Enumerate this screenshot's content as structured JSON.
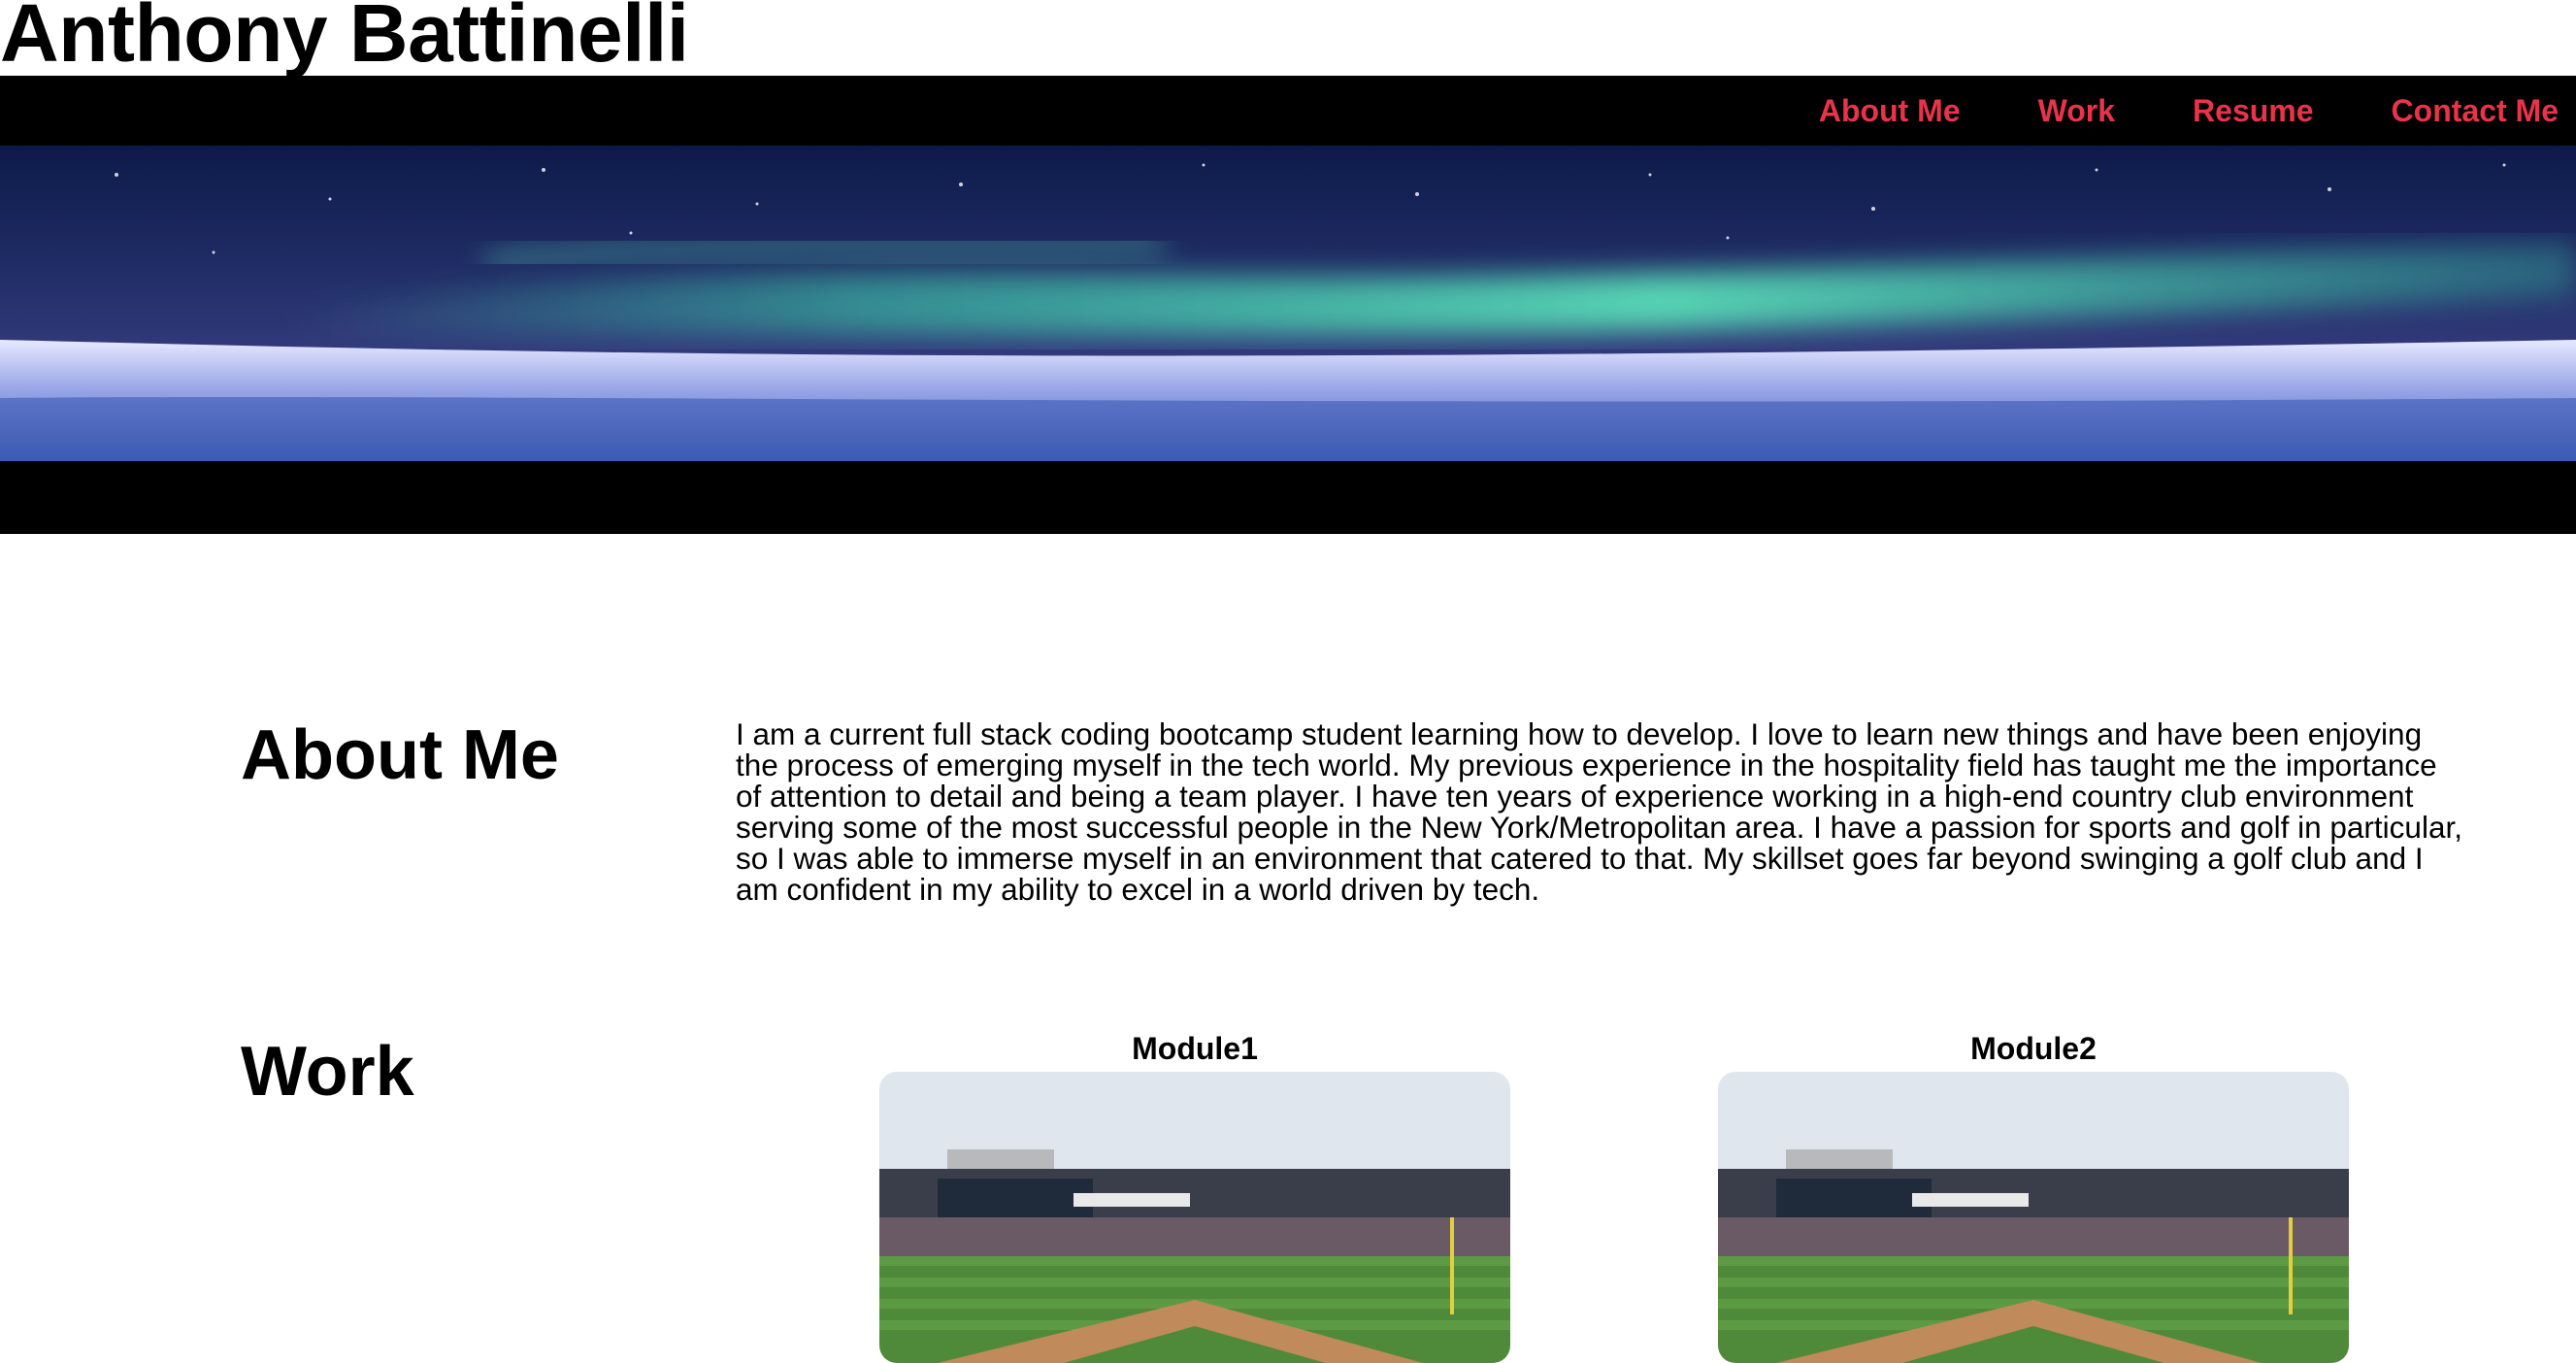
{
  "header": {
    "site_title": "Anthony Battinelli"
  },
  "nav": {
    "items": [
      {
        "label": "About Me"
      },
      {
        "label": "Work"
      },
      {
        "label": "Resume"
      },
      {
        "label": "Contact Me"
      }
    ],
    "link_color": "#e8334a",
    "bar_color": "#000000"
  },
  "hero": {
    "image_description_icon": "aurora-landscape-image"
  },
  "about": {
    "heading": "About Me",
    "body": "I am a current full stack coding bootcamp student learning how to develop. I love to learn new things and have been enjoying the process of emerging myself in the tech world. My previous experience in the hospitality field has taught me the importance of attention to detail and being a team player. I have ten years of experience working in a high-end country club environment serving some of the most successful people in the New York/Metropolitan area. I have a passion for sports and golf in particular, so I was able to immerse myself in an environment that catered to that. My skillset goes far beyond swinging a golf club and I am confident in my ability to excel in a world driven by tech."
  },
  "work": {
    "heading": "Work",
    "modules": [
      {
        "title": "Module1",
        "image_icon": "baseball-stadium-image"
      },
      {
        "title": "Module2",
        "image_icon": "baseball-stadium-image"
      }
    ]
  }
}
